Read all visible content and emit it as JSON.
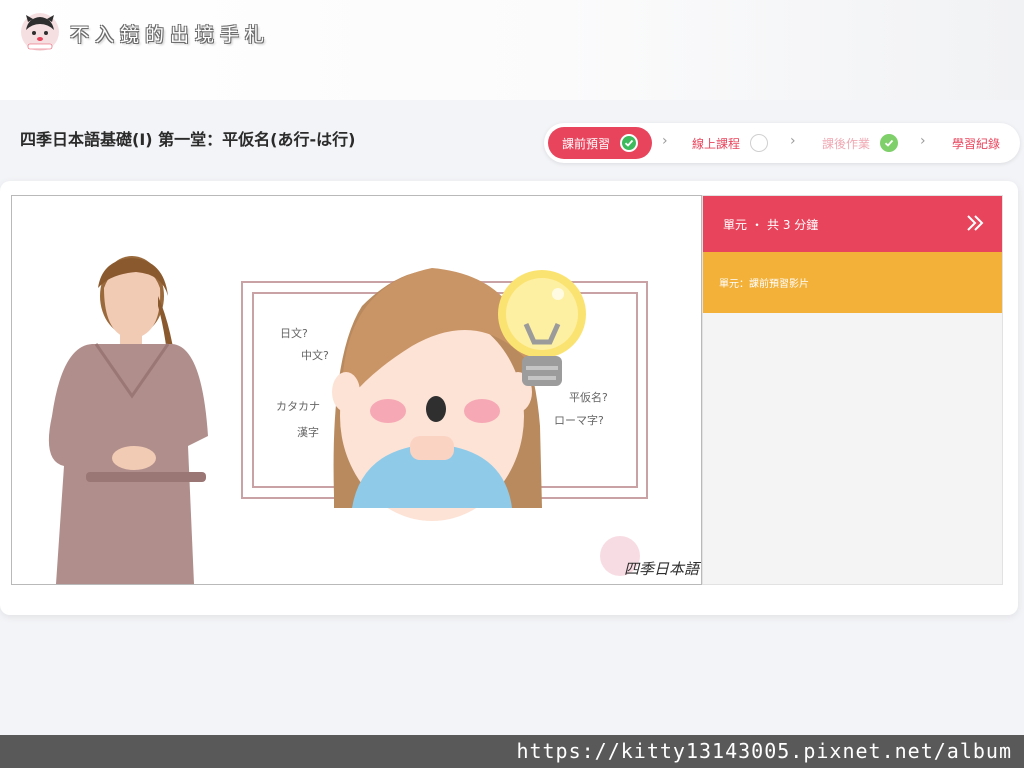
{
  "brand": {
    "title": "不入鏡的出境手札",
    "logo_icon": "cartoon-face-logo-icon"
  },
  "course": {
    "title": "四季日本語基礎(I) 第一堂：平仮名(あ行-は行)"
  },
  "steps": [
    {
      "label": "課前預習",
      "state": "active-complete"
    },
    {
      "label": "線上課程",
      "state": "incomplete"
    },
    {
      "label": "課後作業",
      "state": "complete"
    },
    {
      "label": "學習紀錄",
      "state": "link"
    }
  ],
  "video": {
    "words": [
      "日文?",
      "中文?",
      "カタカナ",
      "漢字",
      "平仮名?",
      "ローマ字?"
    ],
    "watermark": "四季日本語"
  },
  "panel": {
    "header_label": "單元",
    "header_sep": "・",
    "header_duration": "共 3 分鐘",
    "item_label": "單元：課前預習影片"
  },
  "footer": {
    "url": "https://kitty13143005.pixnet.net/album"
  },
  "colors": {
    "accent": "#e8455d",
    "item": "#f3b13a",
    "check": "#7fcf6a"
  }
}
